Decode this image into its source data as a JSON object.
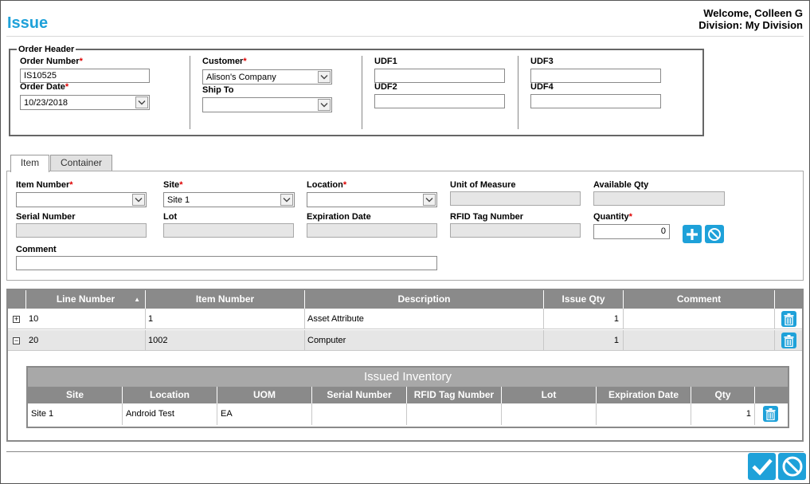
{
  "page": {
    "title": "Issue",
    "welcome": "Welcome, Colleen G",
    "division": "Division: My Division"
  },
  "order_header": {
    "legend": "Order Header",
    "order_number": {
      "label": "Order Number",
      "value": "IS10525"
    },
    "order_date": {
      "label": "Order Date",
      "value": "10/23/2018"
    },
    "customer": {
      "label": "Customer",
      "value": "Alison's Company"
    },
    "ship_to": {
      "label": "Ship To",
      "value": ""
    },
    "udf1": {
      "label": "UDF1",
      "value": ""
    },
    "udf2": {
      "label": "UDF2",
      "value": ""
    },
    "udf3": {
      "label": "UDF3",
      "value": ""
    },
    "udf4": {
      "label": "UDF4",
      "value": ""
    },
    "required_marker": "*"
  },
  "tabs": [
    {
      "label": "Item",
      "active": true
    },
    {
      "label": "Container",
      "active": false
    }
  ],
  "item_form": {
    "item_number": {
      "label": "Item Number",
      "value": ""
    },
    "site": {
      "label": "Site",
      "value": "Site 1"
    },
    "location": {
      "label": "Location",
      "value": ""
    },
    "unit_of_measure": {
      "label": "Unit of Measure",
      "value": ""
    },
    "available_qty": {
      "label": "Available Qty",
      "value": ""
    },
    "serial_number": {
      "label": "Serial Number",
      "value": ""
    },
    "lot": {
      "label": "Lot",
      "value": ""
    },
    "expiration_date": {
      "label": "Expiration Date",
      "value": ""
    },
    "rfid_tag_number": {
      "label": "RFID Tag Number",
      "value": ""
    },
    "quantity": {
      "label": "Quantity",
      "value": "0"
    },
    "comment": {
      "label": "Comment",
      "value": ""
    }
  },
  "lines_grid": {
    "columns": [
      "Line Number",
      "Item Number",
      "Description",
      "Issue Qty",
      "Comment"
    ],
    "sort_indicator": "▲",
    "rows": [
      {
        "expander": "+",
        "line_number": "10",
        "item_number": "1",
        "description": "Asset Attribute",
        "issue_qty": "1",
        "comment": ""
      },
      {
        "expander": "−",
        "line_number": "20",
        "item_number": "1002",
        "description": "Computer",
        "issue_qty": "1",
        "comment": ""
      }
    ]
  },
  "issued_inventory": {
    "title": "Issued Inventory",
    "columns": [
      "Site",
      "Location",
      "UOM",
      "Serial Number",
      "RFID Tag Number",
      "Lot",
      "Expiration Date",
      "Qty"
    ],
    "rows": [
      {
        "site": "Site 1",
        "location": "Android Test",
        "uom": "EA",
        "serial_number": "",
        "rfid_tag_number": "",
        "lot": "",
        "expiration_date": "",
        "qty": "1"
      }
    ]
  },
  "colors": {
    "accent": "#1ea1d9",
    "header_gray": "#8a8a8a",
    "required": "#dd0000"
  }
}
